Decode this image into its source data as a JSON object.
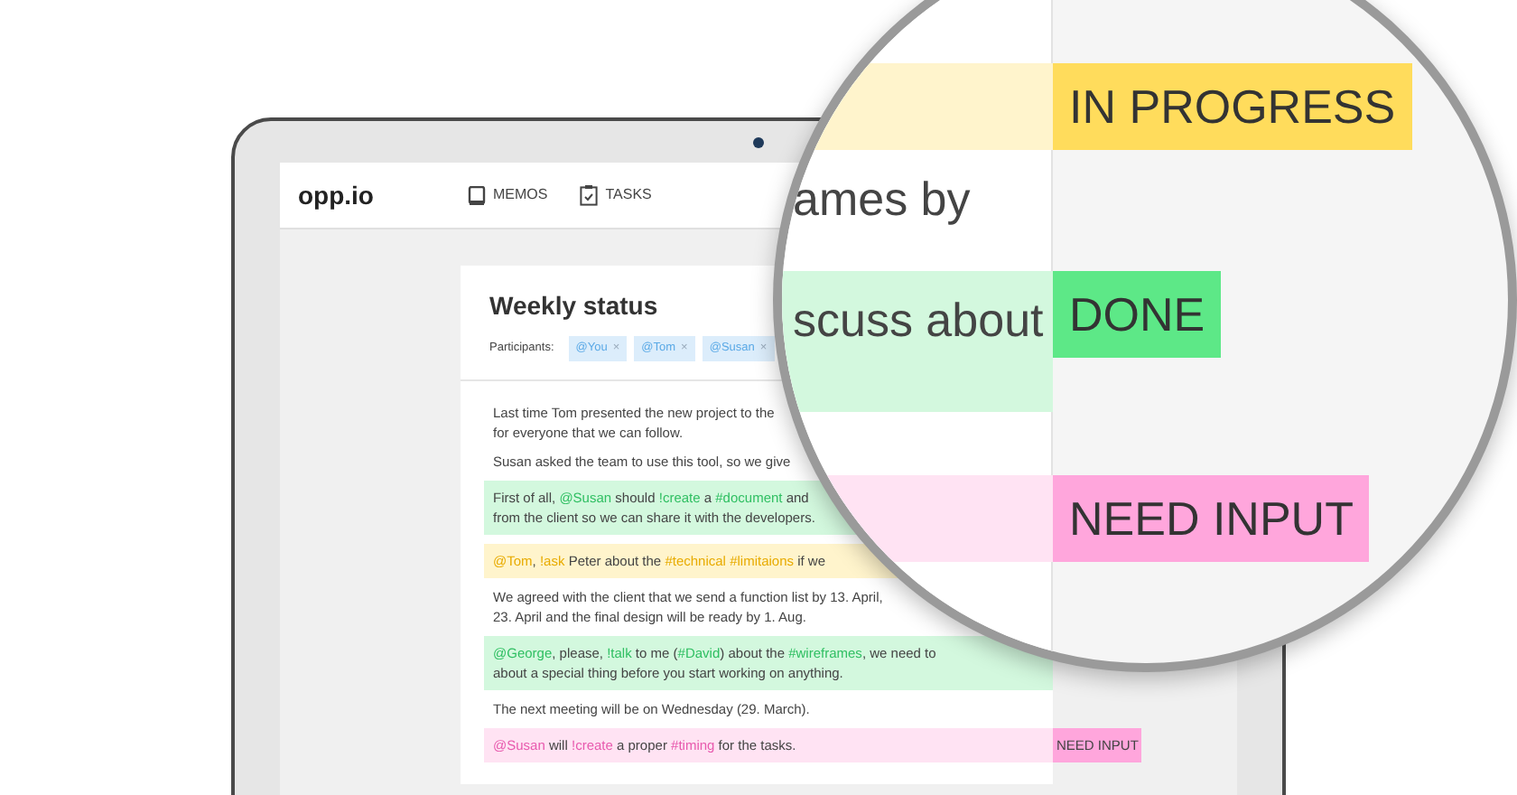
{
  "app": {
    "logo": "opp.io",
    "nav": [
      {
        "label": "MEMOS"
      },
      {
        "label": "TASKS"
      }
    ]
  },
  "memo": {
    "title": "Weekly status",
    "participants_label": "Participants:",
    "participants": [
      {
        "name": "@You",
        "remove": "×"
      },
      {
        "name": "@Tom",
        "remove": "×"
      },
      {
        "name": "@Susan",
        "remove": "×"
      }
    ],
    "paragraphs": [
      {
        "kind": "plain",
        "lines": [
          [
            {
              "text": "Last time Tom presented the new project to the",
              "token": false
            }
          ],
          [
            {
              "text": "for everyone that we can follow.",
              "token": false
            }
          ]
        ]
      },
      {
        "kind": "plain",
        "lines": [
          [
            {
              "text": "Susan asked the team to use this tool, so we give",
              "token": false
            }
          ]
        ]
      },
      {
        "kind": "done",
        "lines": [
          [
            {
              "text": "First of all, ",
              "token": false
            },
            {
              "text": "@Susan",
              "token": true
            },
            {
              "text": " should ",
              "token": false
            },
            {
              "text": "!create",
              "token": true
            },
            {
              "text": " a ",
              "token": false
            },
            {
              "text": "#document",
              "token": true
            },
            {
              "text": " and",
              "token": false
            }
          ],
          [
            {
              "text": "from the client so we can share it with the developers.",
              "token": false
            }
          ]
        ]
      },
      {
        "kind": "in_progress",
        "lines": [
          [
            {
              "text": "@Tom",
              "token": true
            },
            {
              "text": ", ",
              "token": false
            },
            {
              "text": "!ask",
              "token": true
            },
            {
              "text": " Peter about the ",
              "token": false
            },
            {
              "text": "#technical ",
              "token": true
            },
            {
              "text": "#limitaions",
              "token": true
            },
            {
              "text": " if we",
              "token": false
            }
          ]
        ]
      },
      {
        "kind": "plain",
        "lines": [
          [
            {
              "text": "We agreed with the client that we send a function list by 13. April,",
              "token": false
            }
          ],
          [
            {
              "text": "23. April and the final design will be ready by 1. Aug.",
              "token": false
            }
          ]
        ]
      },
      {
        "kind": "done",
        "lines": [
          [
            {
              "text": "@George",
              "token": true
            },
            {
              "text": ", please, ",
              "token": false
            },
            {
              "text": "!talk",
              "token": true
            },
            {
              "text": " to me (",
              "token": false
            },
            {
              "text": "#David",
              "token": true
            },
            {
              "text": ") about the ",
              "token": false
            },
            {
              "text": "#wireframes",
              "token": true
            },
            {
              "text": ", we need to",
              "token": false
            }
          ],
          [
            {
              "text": "about a special thing before you start working on anything.",
              "token": false
            }
          ]
        ]
      },
      {
        "kind": "plain",
        "lines": [
          [
            {
              "text": "The next meeting will be on Wednesday (29. March).",
              "token": false
            }
          ]
        ]
      },
      {
        "kind": "need_input",
        "label": "NEED INPUT",
        "lines": [
          [
            {
              "text": "@Susan",
              "token": true
            },
            {
              "text": " will ",
              "token": false
            },
            {
              "text": "!create",
              "token": true
            },
            {
              "text": " a proper ",
              "token": false
            },
            {
              "text": "#timing",
              "token": true
            },
            {
              "text": " for the tasks.",
              "token": false
            }
          ]
        ]
      }
    ]
  },
  "magnifier": {
    "rows": [
      {
        "kind": "in_progress",
        "label": "IN PROGRESS"
      },
      {
        "kind": "text",
        "text": "ames by"
      },
      {
        "kind": "done",
        "text": "scuss about",
        "label": "DONE"
      },
      {
        "kind": "need_input",
        "label": "NEED INPUT"
      }
    ]
  }
}
